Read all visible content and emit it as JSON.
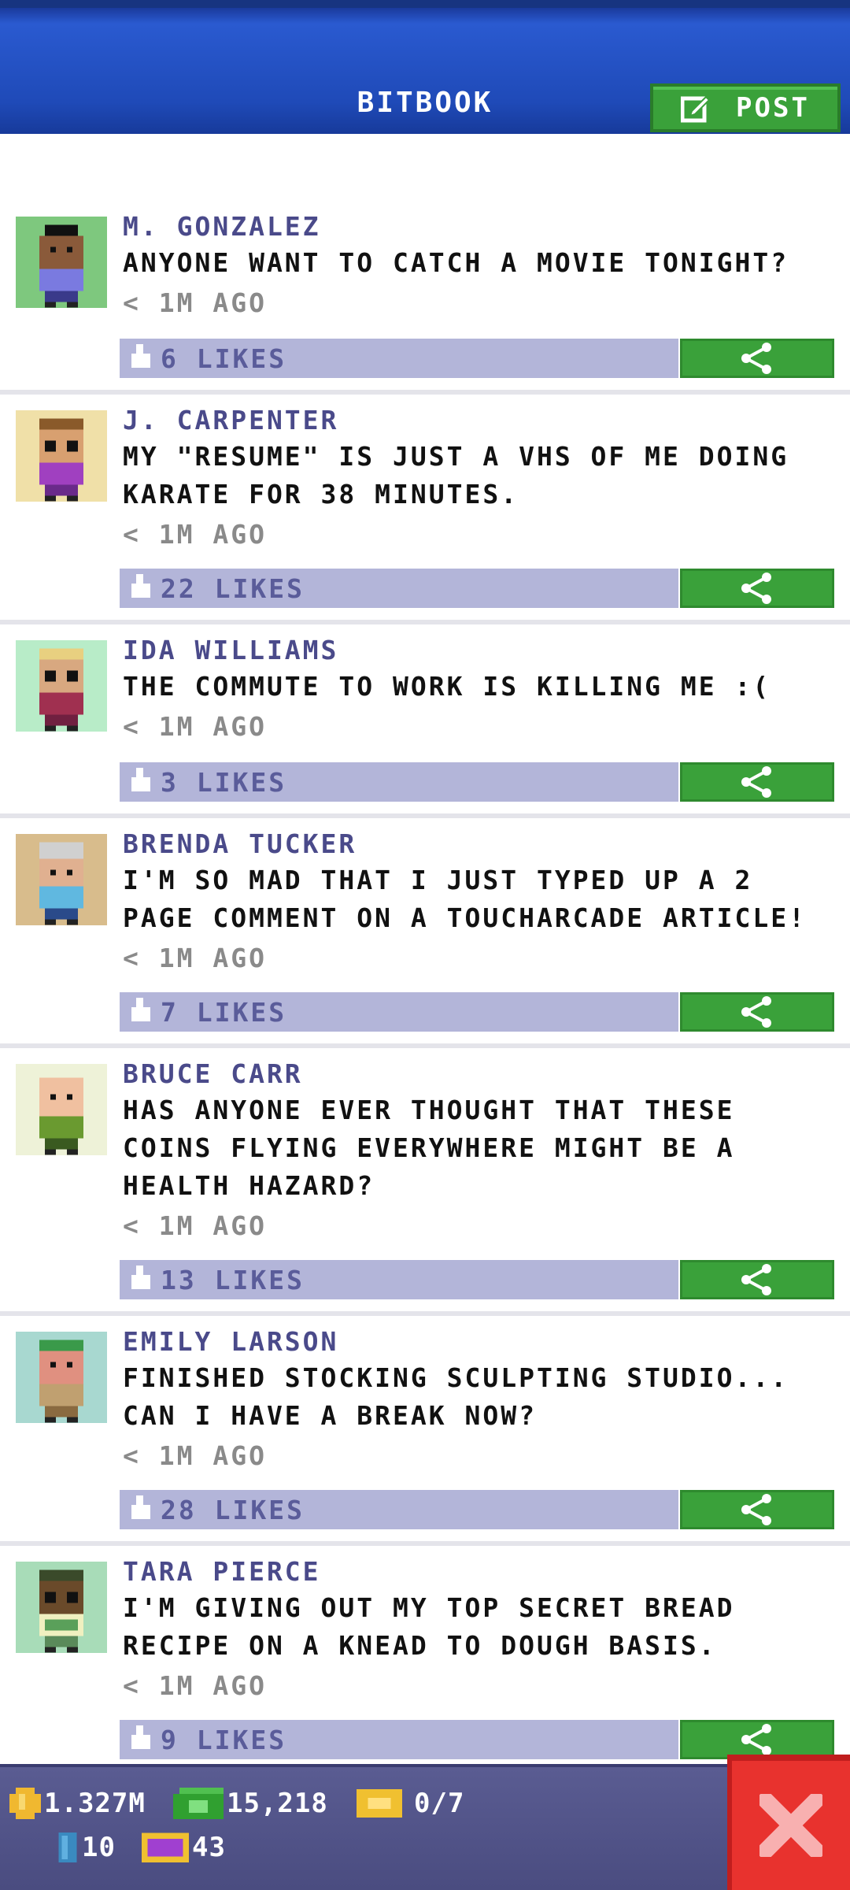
{
  "header": {
    "title": "BITBOOK",
    "post_label": "POST"
  },
  "posts": [
    {
      "author": "M. GONZALEZ",
      "message": "ANYONE WANT TO CATCH A MOVIE TONIGHT?",
      "time": "< 1M AGO",
      "likes": "6 LIKES",
      "avatar_bg": "#7ec87e"
    },
    {
      "author": "J. CARPENTER",
      "message": "MY \"RESUME\" IS JUST A VHS OF ME DOING KARATE FOR 38 MINUTES.",
      "time": "< 1M AGO",
      "likes": "22 LIKES",
      "avatar_bg": "#f0e0a8"
    },
    {
      "author": "IDA WILLIAMS",
      "message": "THE COMMUTE TO WORK IS KILLING ME :(",
      "time": "< 1M AGO",
      "likes": "3 LIKES",
      "avatar_bg": "#b8ecc8"
    },
    {
      "author": "BRENDA TUCKER",
      "message": "I'M SO MAD THAT I JUST TYPED UP A 2 PAGE COMMENT ON A TOUCHARCADE ARTICLE!",
      "time": "< 1M AGO",
      "likes": "7 LIKES",
      "avatar_bg": "#d8bc8c"
    },
    {
      "author": "BRUCE CARR",
      "message": "HAS ANYONE EVER THOUGHT THAT THESE COINS FLYING EVERYWHERE MIGHT BE A HEALTH HAZARD?",
      "time": "< 1M AGO",
      "likes": "13 LIKES",
      "avatar_bg": "#eef2d8"
    },
    {
      "author": "EMILY LARSON",
      "message": "FINISHED STOCKING SCULPTING STUDIO... CAN I HAVE A BREAK NOW?",
      "time": "< 1M AGO",
      "likes": "28 LIKES",
      "avatar_bg": "#a8d8d0"
    },
    {
      "author": "TARA PIERCE",
      "message": "I'M GIVING OUT MY TOP SECRET BREAD RECIPE ON A KNEAD TO DOUGH BASIS.",
      "time": "< 1M AGO",
      "likes": "9 LIKES",
      "avatar_bg": "#a8dcb8"
    }
  ],
  "status": {
    "coins": "1.327M",
    "cash": "15,218",
    "tickets": "0/7",
    "bits": "10",
    "bux": "43"
  },
  "icons": {
    "post": "edit-icon",
    "like": "thumbs-up-icon",
    "share": "share-icon",
    "close": "close-icon",
    "coin": "coin-icon",
    "cash": "cash-icon",
    "ticket": "ticket-icon",
    "bit": "bit-icon",
    "bux": "bux-icon"
  },
  "colors": {
    "header": "#1f4ab8",
    "button_green": "#3aa13a",
    "like_bar": "#b3b5d9",
    "author": "#4a4a8a",
    "close_red": "#e8322e"
  }
}
